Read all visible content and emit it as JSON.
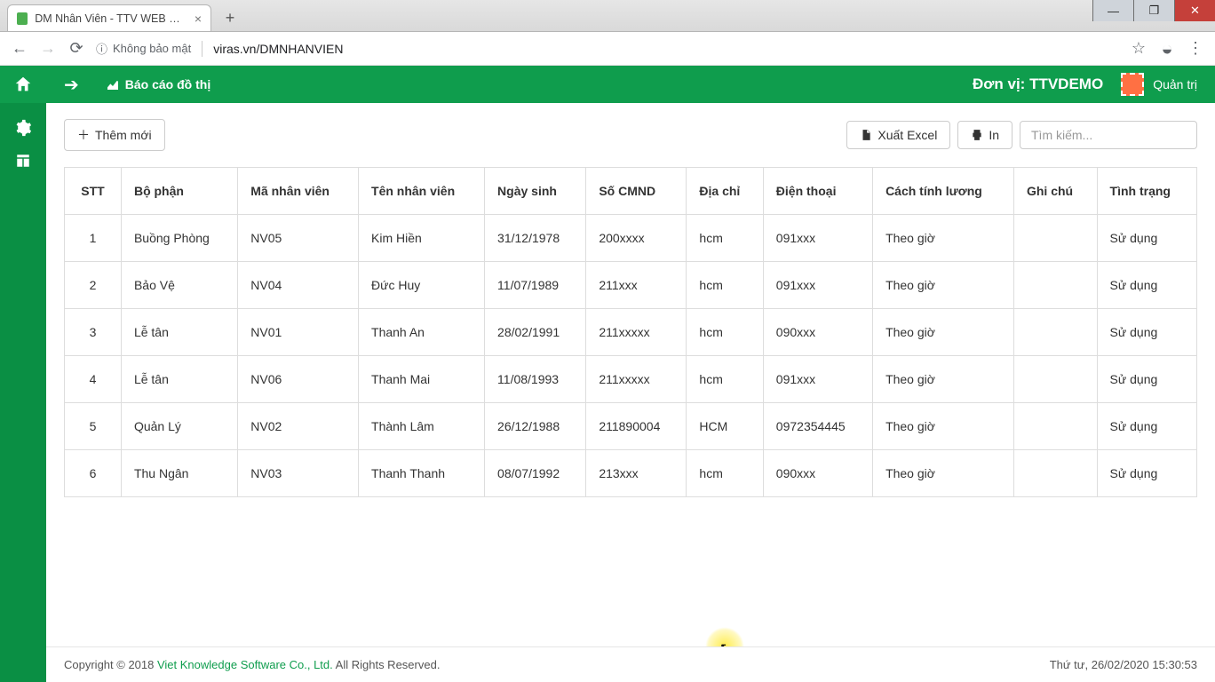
{
  "browser": {
    "tab_title": "DM Nhân Viên - TTV WEB RESO...",
    "security_label": "Không bảo mật",
    "url": "viras.vn/DMNHANVIEN",
    "info_glyph": "ⓘ"
  },
  "topbar": {
    "report_label": "Báo cáo đồ thị",
    "unit_prefix": "Đơn vị: ",
    "unit_value": "TTVDEMO",
    "user_label": "Quản trị"
  },
  "toolbar": {
    "add_label": "Thêm mới",
    "export_label": "Xuất Excel",
    "print_label": "In",
    "search_placeholder": "Tìm kiếm..."
  },
  "table": {
    "headers": {
      "stt": "STT",
      "bophan": "Bộ phận",
      "manv": "Mã nhân viên",
      "tennv": "Tên nhân viên",
      "ngaysinh": "Ngày sinh",
      "cmnd": "Số CMND",
      "diachi": "Địa chỉ",
      "dienthoai": "Điện thoại",
      "luong": "Cách tính lương",
      "ghichu": "Ghi chú",
      "tinhtrang": "Tình trạng"
    },
    "rows": [
      {
        "stt": "1",
        "bophan": "Buồng Phòng",
        "manv": "NV05",
        "tennv": "Kim Hiền",
        "ngaysinh": "31/12/1978",
        "cmnd": "200xxxx",
        "diachi": "hcm",
        "dienthoai": "091xxx",
        "luong": "Theo giờ",
        "ghichu": "",
        "tinhtrang": "Sử dụng"
      },
      {
        "stt": "2",
        "bophan": "Bảo Vệ",
        "manv": "NV04",
        "tennv": "Đức Huy",
        "ngaysinh": "11/07/1989",
        "cmnd": "211xxx",
        "diachi": "hcm",
        "dienthoai": "091xxx",
        "luong": "Theo giờ",
        "ghichu": "",
        "tinhtrang": "Sử dụng"
      },
      {
        "stt": "3",
        "bophan": "Lễ tân",
        "manv": "NV01",
        "tennv": "Thanh An",
        "ngaysinh": "28/02/1991",
        "cmnd": "211xxxxx",
        "diachi": "hcm",
        "dienthoai": "090xxx",
        "luong": "Theo giờ",
        "ghichu": "",
        "tinhtrang": "Sử dụng"
      },
      {
        "stt": "4",
        "bophan": "Lễ tân",
        "manv": "NV06",
        "tennv": "Thanh Mai",
        "ngaysinh": "11/08/1993",
        "cmnd": "211xxxxx",
        "diachi": "hcm",
        "dienthoai": "091xxx",
        "luong": "Theo giờ",
        "ghichu": "",
        "tinhtrang": "Sử dụng"
      },
      {
        "stt": "5",
        "bophan": "Quản Lý",
        "manv": "NV02",
        "tennv": "Thành Lâm",
        "ngaysinh": "26/12/1988",
        "cmnd": "211890004",
        "diachi": "HCM",
        "dienthoai": "0972354445",
        "luong": "Theo giờ",
        "ghichu": "",
        "tinhtrang": "Sử dụng"
      },
      {
        "stt": "6",
        "bophan": "Thu Ngân",
        "manv": "NV03",
        "tennv": "Thanh Thanh",
        "ngaysinh": "08/07/1992",
        "cmnd": "213xxx",
        "diachi": "hcm",
        "dienthoai": "090xxx",
        "luong": "Theo giờ",
        "ghichu": "",
        "tinhtrang": "Sử dụng"
      }
    ]
  },
  "footer": {
    "copy_prefix": "Copyright © 2018 ",
    "company": "Viet Knowledge Software Co., Ltd.",
    "copy_suffix": " All Rights Reserved.",
    "datetime": "Thứ tư, 26/02/2020 15:30:53"
  }
}
